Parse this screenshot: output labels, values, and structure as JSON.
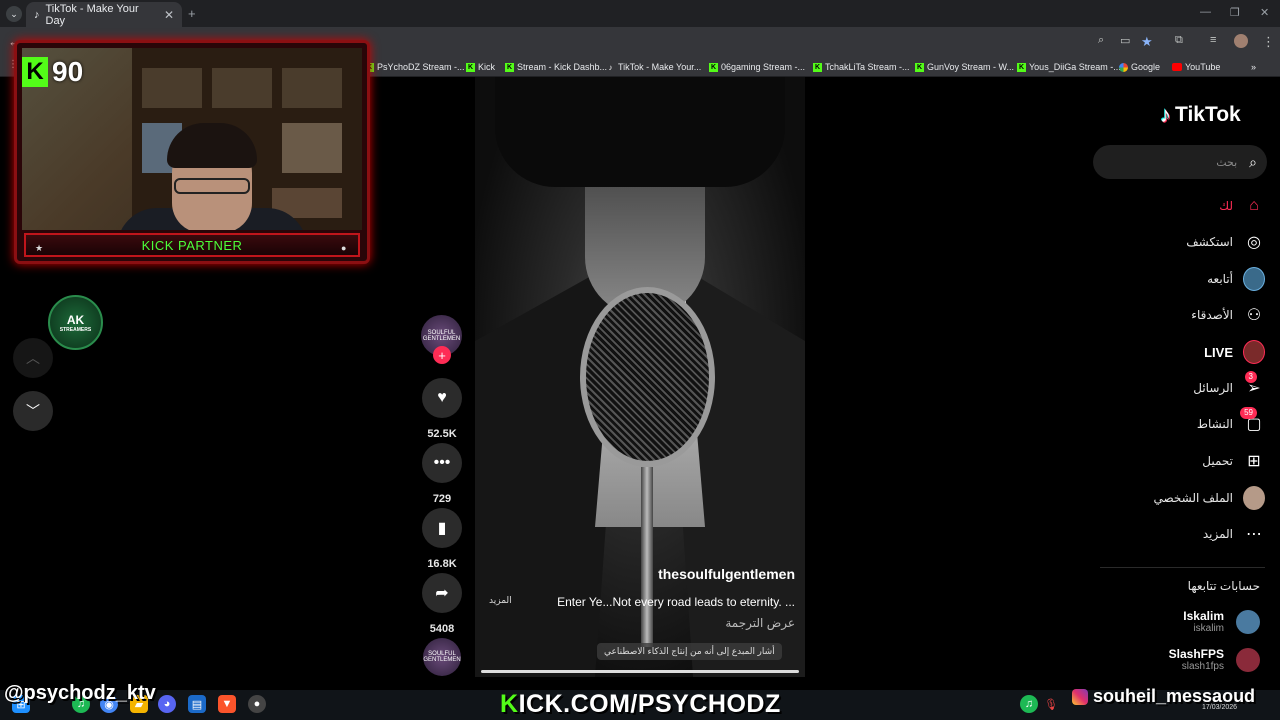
{
  "browser": {
    "tab_title": "TikTok - Make Your Day",
    "tab_icon": "tiktok-icon",
    "bookmarks": [
      {
        "label": "PsYchoDZ Stream -...",
        "icon": "kick"
      },
      {
        "label": "Kick",
        "icon": "kick"
      },
      {
        "label": "Stream - Kick Dashb...",
        "icon": "kick"
      },
      {
        "label": "TikTok - Make Your...",
        "icon": "tiktok"
      },
      {
        "label": "06gaming Stream -...",
        "icon": "kick"
      },
      {
        "label": "TchakLiTa Stream -...",
        "icon": "kick"
      },
      {
        "label": "GunVoy Stream - W...",
        "icon": "kick"
      },
      {
        "label": "Yous_DiiGa Stream -...",
        "icon": "kick"
      },
      {
        "label": "Google",
        "icon": "google"
      },
      {
        "label": "YouTube",
        "icon": "youtube"
      }
    ]
  },
  "overlay": {
    "kick_count": "90",
    "partner_label": "KICK PARTNER",
    "handle_left": "@psychodz_ktv",
    "kick_url_k": "K",
    "kick_url_rest": "ICK.COM/PSYCHODZ",
    "handle_right": "souheil_messaoud",
    "logo_text": "AK",
    "logo_sub": "STREAMERS"
  },
  "video": {
    "creator": "thesoulfulgentlemen",
    "caption": "Enter Ye...Not every road leads to eternity. ...",
    "more": "المزيد",
    "translate": "عرض الترجمة",
    "ai_note": "أشار المبدع إلى أنه من إنتاج الذكاء الاصطناعي",
    "avatar_text": "SOULFUL GENTLEMEN",
    "progress": 1.0
  },
  "actions": {
    "likes": "52.5K",
    "comments": "729",
    "saves": "16.8K",
    "shares": "5408"
  },
  "sidebar": {
    "brand": "TikTok",
    "search_placeholder": "بحث",
    "nav": [
      {
        "label": "لك",
        "icon": "home"
      },
      {
        "label": "استكشف",
        "icon": "compass"
      },
      {
        "label": "أتابعه",
        "icon": "avatar"
      },
      {
        "label": "الأصدقاء",
        "icon": "friends"
      },
      {
        "label": "LIVE",
        "icon": "live"
      },
      {
        "label": "الرسائل",
        "icon": "send",
        "badge": "3"
      },
      {
        "label": "النشاط",
        "icon": "inbox",
        "badge": "59"
      },
      {
        "label": "تحميل",
        "icon": "upload"
      },
      {
        "label": "الملف الشخصي",
        "icon": "profile"
      },
      {
        "label": "المزيد",
        "icon": "more"
      }
    ],
    "following_title": "حسابات تتابعها",
    "following": [
      {
        "name": "Iskalim",
        "handle": "iskalim"
      },
      {
        "name": "SlashFPS",
        "handle": "slash1fps"
      }
    ]
  },
  "taskbar": {
    "date": "17/03/2026"
  },
  "colors": {
    "accent": "#fe2c55",
    "kick_green": "#53fc18"
  }
}
